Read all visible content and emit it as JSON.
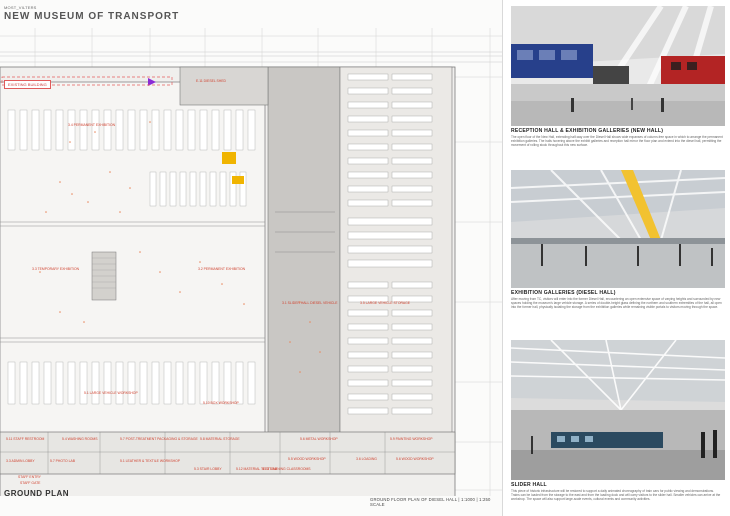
{
  "header": {
    "kicker": "MOST_VILTERS",
    "title": "NEW MUSEUM OF TRANSPORT"
  },
  "legend": {
    "chip_label": "EXISTING BUILDING"
  },
  "footer": {
    "ground_plan_label": "GROUND PLAN",
    "plan_caption": "GROUND FLOOR PLAN OF DIESEL HALL | 1:1000 | 1:250 SCALE"
  },
  "rooms": [
    {
      "id": "r1",
      "label": "E.11 DIESEL SHED"
    },
    {
      "id": "r2",
      "label": "3.4 PERMANENT EXHIBITION"
    },
    {
      "id": "r3",
      "label": "3.3 TEMPORARY EXHIBITION"
    },
    {
      "id": "r4",
      "label": "3.2 PERMANENT EXHIBITION"
    },
    {
      "id": "r5",
      "label": "3.1 SLIDER HALL DIESEL VEHICLE"
    },
    {
      "id": "r6",
      "label": "3.5 LARGE VEHICLE STORAGE"
    },
    {
      "id": "r7",
      "label": "5.1 LARGE VEHICLE WORKSHOP"
    },
    {
      "id": "r8",
      "label": "5.10 BOX WORKSHOP"
    },
    {
      "id": "r9",
      "label": "5.11 STAFF RESTROOM"
    },
    {
      "id": "r10",
      "label": "5.4 WASHING ROOMS"
    },
    {
      "id": "r11",
      "label": "5.7 POST-TREATMENT PACKAGING & STORAGE"
    },
    {
      "id": "r12",
      "label": "5.8 MATERIAL STORAGE"
    },
    {
      "id": "r13",
      "label": "5.6 METAL WORKSHOP"
    },
    {
      "id": "r14",
      "label": "5.9 PAINTING WORKSHOP"
    },
    {
      "id": "r15",
      "label": "3.3 ADMIN LOBBY"
    },
    {
      "id": "r16",
      "label": "5.7 PHOTO LAB"
    },
    {
      "id": "r17",
      "label": "5.1 LEATHER & TEXTILE WORKSHOP"
    },
    {
      "id": "r18",
      "label": "5.3 STAIR LOBBY"
    },
    {
      "id": "r19",
      "label": "5.12 MATERIAL TEST LAB"
    },
    {
      "id": "r20",
      "label": "4.13 TRAINING CLASSROOMS"
    },
    {
      "id": "r21",
      "label": "5.5 WOOD WORKSHOP"
    },
    {
      "id": "r22",
      "label": "5.6 WOOD WORKSHOP"
    },
    {
      "id": "r23",
      "label": "STAFF ENTRY"
    },
    {
      "id": "r24",
      "label": "STAFF GATE"
    },
    {
      "id": "r25",
      "label": "3.6 LOADING"
    }
  ],
  "panels": [
    {
      "title": "RECEPTION HALL & EXHIBITION GALLERIES (NEW HALL)",
      "body": "The open floor of the New Hall, extending half-way over the Diesel Hall shows wide expanses of column-free space in which to arrange the permanent exhibition galleries. The halls hovering above the exhibit galleries and reception hall mirror the floor plan and extend into the diesel hall, permitting the movement of rolling stock throughout this new surface."
    },
    {
      "title": "EXHIBITION GALLERIES (DIESEL HALL)",
      "body": "After moving from TC, visitors will enter into the former Diesel Hall, encountering an open extensive space of varying heights and surrounded by new spaces holding the museum's large vehicle storage. A series of double-height glass defining the northern and southern extremities of the hall, all open into the former hall, physically isolating the storage from the exhibition galleries while remaining visible portals to visitors moving through the space."
    },
    {
      "title": "SLIDER HALL",
      "body": "This piece of historic infrastructure will be restored to support a daily animated choreography of train cars for public viewing and demonstrations. Trains can be loaded from the storage to the east and from the loading dock and will carry visitors to the slider hall. Smaller vehicles can arrive at the workshop. The space will also support large-scale events, cultural events and community activities."
    }
  ]
}
